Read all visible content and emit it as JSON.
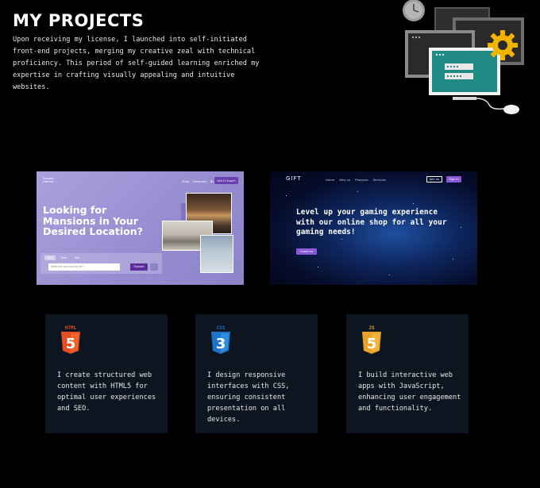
{
  "header": {
    "title": "MY PROJECTS",
    "intro": "Upon receiving my license, I launched into self-initiated front-end projects, merging my creative zeal with technical proficiency. This period of self-guided learning enriched my expertise in crafting visually appealing and intuitive websites."
  },
  "projects": [
    {
      "logo_line1": "Square",
      "logo_line2": "Homes",
      "nav": [
        "Shop",
        "Company",
        "Buy"
      ],
      "cta": "Get in touch",
      "heading": "Looking for Mansions in Your Desired Location?",
      "tabs": [
        "Buy",
        "Rent",
        "Sell"
      ],
      "search_placeholder": "What are you looking for?",
      "search_button": "Explore",
      "accent": "#a9a1dc"
    },
    {
      "logo": "GIFT",
      "nav": [
        "Home",
        "Why us",
        "Products",
        "Services"
      ],
      "join": "Join us",
      "signin": "Sign in",
      "heading": "Level up your gaming experience with our online shop for all your gaming needs!",
      "cta": "Come on",
      "accent": "#8a5ad6"
    }
  ],
  "skills": [
    {
      "badge": "HTML",
      "digit": "5",
      "color": "#e44d26",
      "icon": "html5-icon",
      "text": "I create structured web content with HTML5 for optimal user experiences and SEO."
    },
    {
      "badge": "CSS",
      "digit": "3",
      "color": "#1e73c8",
      "icon": "css3-icon",
      "text": "I design responsive interfaces with CSS, ensuring consistent presentation on all devices."
    },
    {
      "badge": "JS",
      "digit": "5",
      "color": "#e8a227",
      "icon": "js-icon",
      "text": "I build interactive web apps with JavaScript, enhancing user engagement and functionality."
    }
  ]
}
